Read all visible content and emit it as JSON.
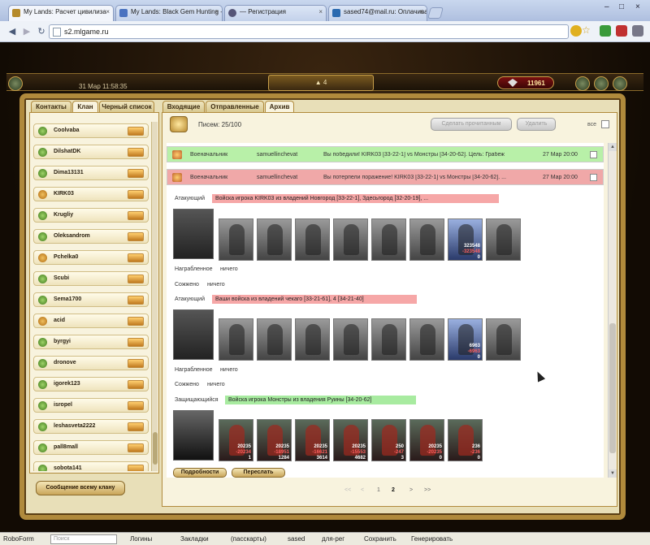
{
  "browser": {
    "tabs": [
      {
        "title": "My Lands: Расчет цивилиза"
      },
      {
        "title": "My Lands: Black Gem Hunting -"
      },
      {
        "title": "— Регистрация"
      },
      {
        "title": "sased74@mail.ru: Оплачивае"
      }
    ],
    "close_glyph": "×",
    "address": "s2.mlgame.ru",
    "window_controls": [
      "–",
      "□",
      "×"
    ]
  },
  "game": {
    "datetime": "31 Мар 11:58:35",
    "center_count": "4",
    "coins": "11961"
  },
  "left_panel": {
    "tabs": [
      "Контакты",
      "Клан",
      "Черный список"
    ],
    "members": [
      "Coolvaba",
      "DilshatDK",
      "Dima13131",
      "KIRK03",
      "Krugliy",
      "Oleksandrom",
      "Pchelka0",
      "Scubi",
      "Sema1700",
      "acid",
      "byrgyi",
      "dronove",
      "igorek123",
      "isropel",
      "leshasveta2222",
      "pall8mall",
      "sobota141"
    ],
    "message_all": "Сообщение всему клану"
  },
  "right_panel": {
    "tabs": [
      "Входящие",
      "Отправленные",
      "Архив"
    ],
    "letters_label": "Писем: 25/100",
    "mark_read": "Сделать прочитанным",
    "delete": "Удалить",
    "all_label": "все",
    "messages": [
      {
        "sender": "Военачальник",
        "from": "samuellinchevat",
        "text": "Вы победили! KIRK03 [33-22-1] vs Монстры [34-20-62]. Цель: Грабеж",
        "date": "27 Мар 20:00",
        "status": "win"
      },
      {
        "sender": "Военачальник",
        "from": "samuellinchevat",
        "text": "Вы потерпели поражение! KIRK03 [33-22-1] vs Монстры [34-20-62]. ...",
        "date": "27 Мар 20:00",
        "status": "lose"
      }
    ],
    "battle": {
      "attacker1_label": "Атакующий",
      "attacker1_bar": "Войска игрока KIRK03 из владений Новгород [33-22-1], Здесьгород [32-20-19], ...",
      "attacker1_hero": {
        "n1": "323548",
        "n2": "-323548",
        "n3": "0"
      },
      "loot_label": "Награбленное",
      "nothing": "ничего",
      "burned_label": "Сожжено",
      "attacker2_label": "Атакующий",
      "attacker2_bar": "Ваши войска из владений чекаго [33-21-61], 4 [34-21-40]",
      "attacker2_hero": {
        "n1": "6963",
        "n2": "-6963",
        "n3": "0"
      },
      "defender_label": "Защищающийся",
      "defender_bar": "Войска игрока Монстры из владения Руины [34-20-62]",
      "defenders": [
        {
          "n1": "20235",
          "n2": "-20234",
          "n3": "1"
        },
        {
          "n1": "20235",
          "n2": "-18951",
          "n3": "1284"
        },
        {
          "n1": "20235",
          "n2": "-16621",
          "n3": "3614"
        },
        {
          "n1": "20235",
          "n2": "-15553",
          "n3": "4682"
        },
        {
          "n1": "250",
          "n2": "-247",
          "n3": "3"
        },
        {
          "n1": "20235",
          "n2": "-20235",
          "n3": "0"
        },
        {
          "n1": "236",
          "n2": "-236",
          "n3": "0"
        }
      ],
      "details_btn": "Подробности",
      "forward_btn": "Переслать"
    },
    "pager": [
      "<<",
      "<",
      "1",
      "2",
      ">",
      ">>"
    ]
  },
  "statusbar": {
    "roboform": "RoboForm",
    "search_placeholder": "Поиск",
    "logins": "Логины",
    "bookmarks": "Закладки",
    "passcards": "(пасскарты)",
    "sased": "sased",
    "forreg": "для-рег",
    "save": "Сохранить",
    "generate": "Генерировать"
  }
}
